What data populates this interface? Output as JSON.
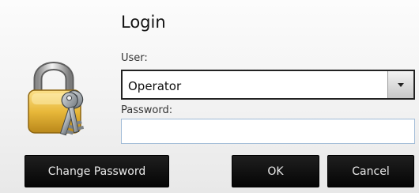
{
  "dialog": {
    "title": "Login",
    "user": {
      "label": "User:",
      "selected": "Operator"
    },
    "password": {
      "label": "Password:",
      "value": ""
    },
    "buttons": {
      "change_password": "Change Password",
      "ok": "OK",
      "cancel": "Cancel"
    },
    "icon": "padlock-with-keys-icon"
  },
  "colors": {
    "button_bg": "#0a0a0a",
    "button_text": "#eaeaea",
    "lock_gold": "#e8b83a",
    "input_border": "#9fbad6"
  }
}
